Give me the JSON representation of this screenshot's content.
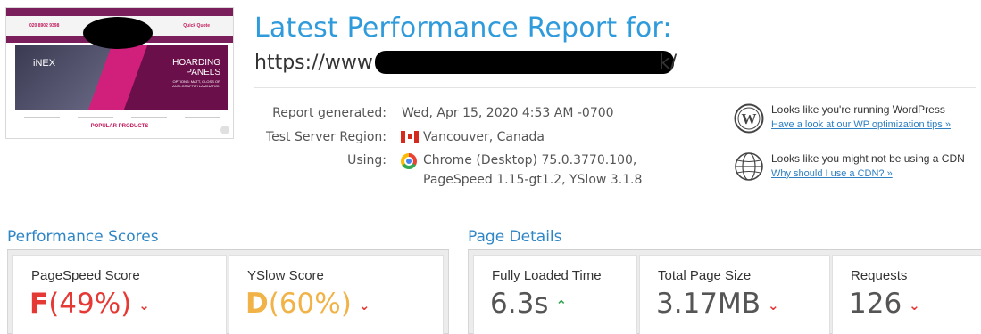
{
  "thumbnail": {
    "phone": "020 8902 9398",
    "quote_label": "Quick Quote",
    "hero_brand": "iNEX",
    "hero_title_line1": "HOARDING",
    "hero_title_line2": "PANELS",
    "hero_subtitle": "OPTIONS: MATT, GLOSS OR ANTI-GRAFFITI LAMINATION",
    "popular_label": "POPULAR PRODUCTS"
  },
  "header": {
    "title": "Latest Performance Report for:",
    "url_prefix": "https://www",
    "url_suffix": "k/"
  },
  "meta": {
    "report_generated_label": "Report generated:",
    "report_generated_value": "Wed, Apr 15, 2020 4:53 AM -0700",
    "region_label": "Test Server Region:",
    "region_value": "Vancouver, Canada",
    "using_label": "Using:",
    "using_line1": "Chrome (Desktop) 75.0.3770.100,",
    "using_line2": "PageSpeed 1.15-gt1.2, YSlow 3.1.8"
  },
  "tips": [
    {
      "icon": "wordpress-icon",
      "title": "Looks like you're running WordPress",
      "link": "Have a look at our WP optimization tips »"
    },
    {
      "icon": "globe-icon",
      "title": "Looks like you might not be using a CDN",
      "link": "Why should I use a CDN? »"
    }
  ],
  "performance": {
    "heading": "Performance Scores",
    "pagespeed_label": "PageSpeed Score",
    "pagespeed_grade": "F",
    "pagespeed_pct": "(49%)",
    "yslow_label": "YSlow Score",
    "yslow_grade": "D",
    "yslow_pct": "(60%)"
  },
  "details": {
    "heading": "Page Details",
    "loaded_label": "Fully Loaded Time",
    "loaded_value": "6.3s",
    "size_label": "Total Page Size",
    "size_value": "3.17MB",
    "requests_label": "Requests",
    "requests_value": "126"
  },
  "colors": {
    "accent_blue": "#2f9bdb",
    "grade_f": "#e53935",
    "grade_d": "#f1b348",
    "trend_up": "#2ea44f"
  }
}
